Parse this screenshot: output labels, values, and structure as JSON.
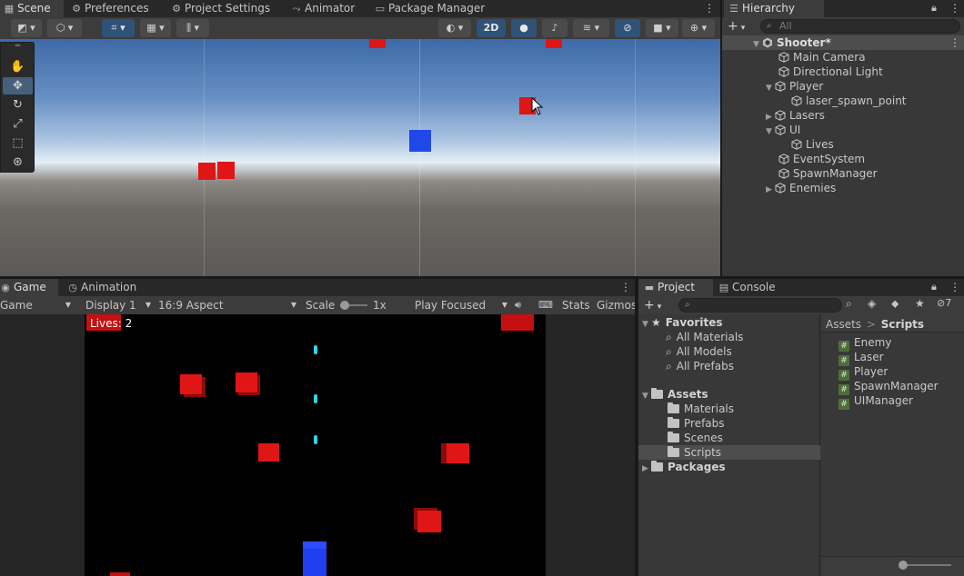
{
  "scene_window": {
    "tabs": [
      {
        "label": "Scene",
        "icon": "grid-icon"
      },
      {
        "label": "Preferences",
        "icon": "gear-icon"
      },
      {
        "label": "Project Settings",
        "icon": "gear-icon"
      },
      {
        "label": "Animator",
        "icon": "animator-icon"
      },
      {
        "label": "Package Manager",
        "icon": "package-icon"
      }
    ],
    "toggle_2d": "2D"
  },
  "hierarchy": {
    "tab_label": "Hierarchy",
    "search_placeholder": "All",
    "scene_name": "Shooter*",
    "items": [
      {
        "label": "Main Camera"
      },
      {
        "label": "Directional Light"
      },
      {
        "label": "Player"
      },
      {
        "label": "laser_spawn_point"
      },
      {
        "label": "Lasers"
      },
      {
        "label": "UI"
      },
      {
        "label": "Lives"
      },
      {
        "label": "EventSystem"
      },
      {
        "label": "SpawnManager"
      },
      {
        "label": "Enemies"
      }
    ]
  },
  "game_window": {
    "tabs": [
      {
        "label": "Game",
        "icon": "gamepad-icon"
      },
      {
        "label": "Animation",
        "icon": "clock-icon"
      }
    ],
    "toolbar": {
      "view": "Game",
      "display": "Display 1",
      "aspect": "16:9 Aspect",
      "scale_label": "Scale",
      "scale_value": "1x",
      "play_mode": "Play Focused",
      "stats": "Stats",
      "gizmos": "Gizmos"
    },
    "lives_text": "Lives: 2"
  },
  "project_window": {
    "tabs": [
      {
        "label": "Project",
        "icon": "folder-icon"
      },
      {
        "label": "Console",
        "icon": "console-icon"
      }
    ],
    "hidden_count": "7",
    "favorites": {
      "label": "Favorites",
      "items": [
        "All Materials",
        "All Models",
        "All Prefabs"
      ]
    },
    "assets": {
      "label": "Assets",
      "items": [
        "Materials",
        "Prefabs",
        "Scenes",
        "Scripts"
      ]
    },
    "packages_label": "Packages",
    "breadcrumb": {
      "root": "Assets",
      "sep": ">",
      "current": "Scripts"
    },
    "scripts": [
      "Enemy",
      "Laser",
      "Player",
      "SpawnManager",
      "UIManager"
    ],
    "script_badge": "#"
  }
}
